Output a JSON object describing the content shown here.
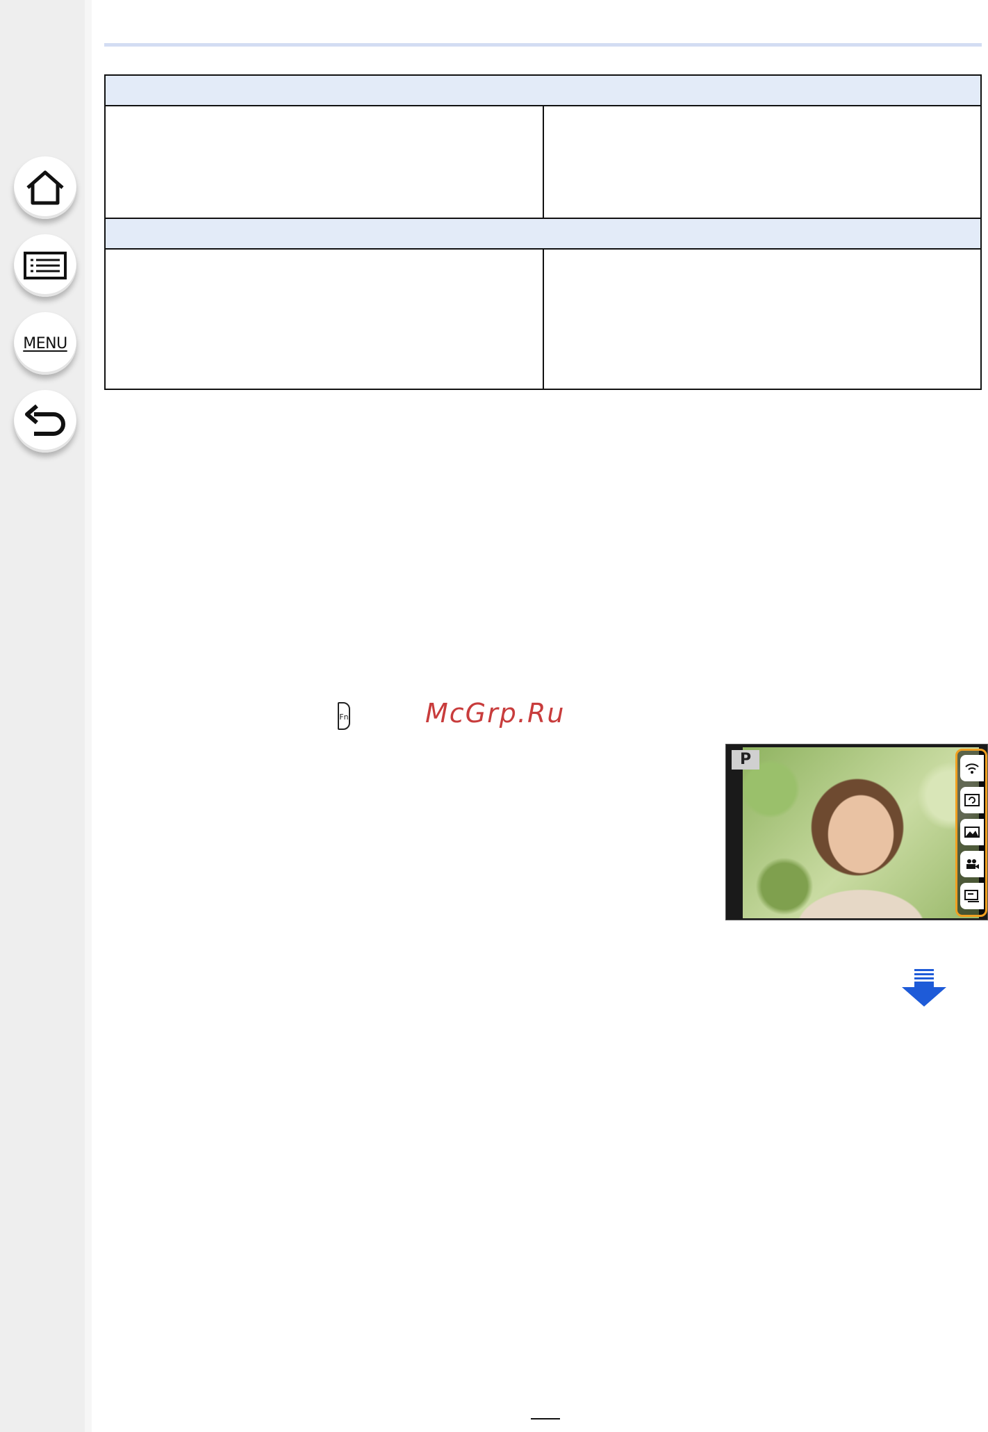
{
  "nav": {
    "home_icon": "home-icon",
    "contents_icon": "list-icon",
    "menu_label": "MENU",
    "back_icon": "back-arrow-icon"
  },
  "body": {
    "fn_button_label": "Fn",
    "watermark": "McGrp.Ru"
  },
  "camera_screen": {
    "mode": "P",
    "tab_icons": [
      "wifi-icon",
      "rotate-icon",
      "picture-icon",
      "video-icon",
      "display-icon"
    ],
    "highlight_color": "#f0a020"
  },
  "colors": {
    "table_header": "#e3ebf8",
    "rule": "#d3ddf3",
    "arrow": "#1e5bd8"
  }
}
